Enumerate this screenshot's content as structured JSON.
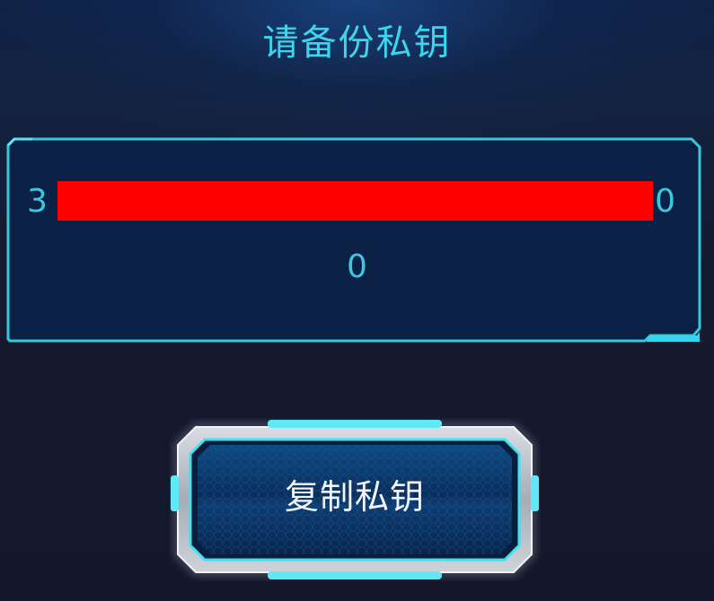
{
  "title": "请备份私钥",
  "private_key": {
    "line1_start": "3",
    "line1_end": "0",
    "line2": "0",
    "redacted": true
  },
  "copy_button": {
    "label": "复制私钥"
  },
  "colors": {
    "accent": "#3ad6ee",
    "key_text": "#3cc6e0",
    "panel_fill": "#0b2045",
    "panel_border": "#35c8dc",
    "redaction": "#ff0000",
    "background": "#14172a"
  }
}
